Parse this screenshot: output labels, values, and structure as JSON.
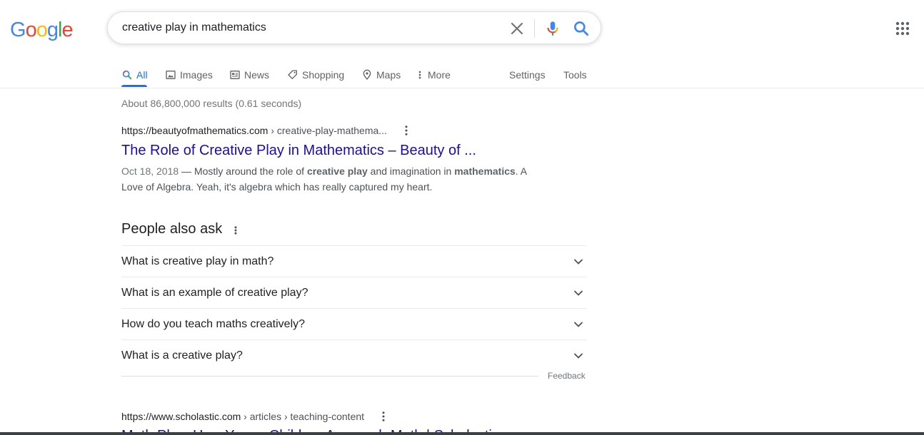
{
  "logo": {
    "letters": [
      "G",
      "o",
      "o",
      "g",
      "l",
      "e"
    ],
    "colors": [
      "#4285f4",
      "#ea4335",
      "#fbbc05",
      "#4285f4",
      "#34a853",
      "#ea4335"
    ]
  },
  "search": {
    "query": "creative play in mathematics"
  },
  "tabs": [
    {
      "label": "All",
      "icon": "search-icon"
    },
    {
      "label": "Images",
      "icon": "image-icon"
    },
    {
      "label": "News",
      "icon": "news-icon"
    },
    {
      "label": "Shopping",
      "icon": "tag-icon"
    },
    {
      "label": "Maps",
      "icon": "map-pin-icon"
    },
    {
      "label": "More",
      "icon": "vertical-dots-icon"
    }
  ],
  "tools": {
    "settings": "Settings",
    "tools": "Tools"
  },
  "result_stats": "About 86,800,000 results (0.61 seconds)",
  "results": [
    {
      "domain": "https://beautyofmathematics.com",
      "path": " › creative-play-mathema...",
      "title": "The Role of Creative Play in Mathematics – Beauty of ...",
      "snippet": {
        "date": "Oct 18, 2018",
        "t1": " — Mostly around the role of ",
        "b1": "creative play",
        "t2": " and imagination in ",
        "b2": "mathematics",
        "t3": ". A Love of Algebra. Yeah, it's algebra which has really captured my heart."
      }
    },
    {
      "domain": "https://www.scholastic.com",
      "path": " › articles › teaching-content",
      "title": "Math Play: How Young Children Approach Math | Scholastic"
    }
  ],
  "paa": {
    "title": "People also ask",
    "questions": [
      "What is creative play in math?",
      "What is an example of creative play?",
      "How do you teach maths creatively?",
      "What is a creative play?"
    ],
    "feedback": "Feedback"
  },
  "colors": {
    "link": "#1a0dab",
    "accent": "#1a73e8"
  }
}
